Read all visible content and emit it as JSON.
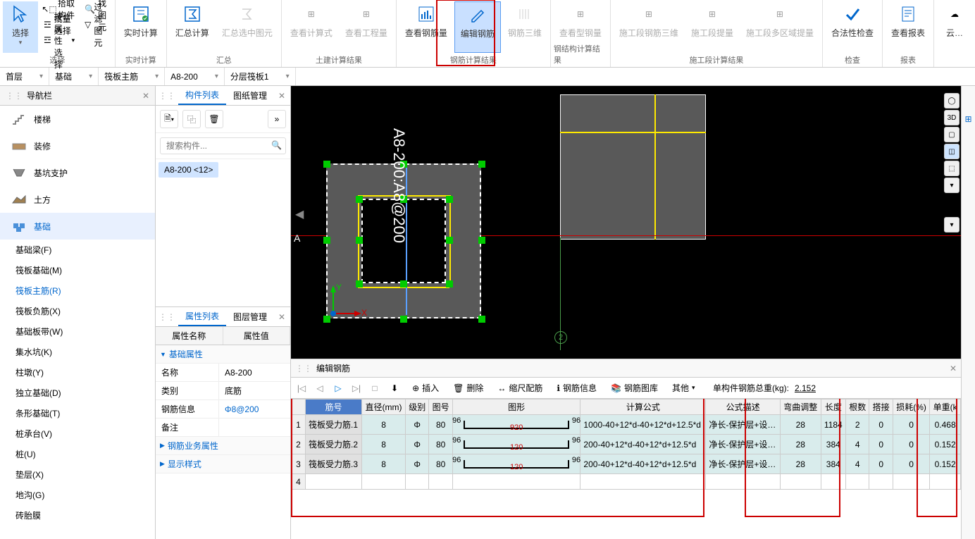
{
  "ribbon": {
    "groups": [
      {
        "label": "选择",
        "select_big": "选择",
        "items": [
          "拾取构件",
          "批量选择",
          "按属性选择",
          "查找图元",
          "过滤图元"
        ]
      },
      {
        "label": "实时计算",
        "big": [
          "实时计算"
        ]
      },
      {
        "label": "汇总",
        "big": [
          "汇总计算",
          "汇总选中图元"
        ]
      },
      {
        "label": "土建计算结果",
        "big": [
          "查看计算式",
          "查看工程量"
        ]
      },
      {
        "label": "钢筋计算结果",
        "big": [
          "查看钢筋量",
          "编辑钢筋",
          "钢筋三维"
        ]
      },
      {
        "label": "钢结构计算结果",
        "big": [
          "查看型钢量"
        ]
      },
      {
        "label": "施工段计算结果",
        "big": [
          "施工段钢筋三维",
          "施工段提量",
          "施工段多区域提量"
        ]
      },
      {
        "label": "检查",
        "big": [
          "合法性检查"
        ]
      },
      {
        "label": "报表",
        "big": [
          "查看报表"
        ]
      },
      {
        "label": "",
        "big": [
          "云…"
        ]
      }
    ]
  },
  "secondary": {
    "items": [
      "首层",
      "基础",
      "筏板主筋",
      "A8-200",
      "分层筏板1"
    ]
  },
  "leftNav": {
    "title": "导航栏",
    "items": [
      {
        "label": "楼梯",
        "icon": "stairs"
      },
      {
        "label": "装修",
        "icon": "decor"
      },
      {
        "label": "基坑支护",
        "icon": "pit"
      },
      {
        "label": "土方",
        "icon": "earth"
      },
      {
        "label": "基础",
        "icon": "foundation",
        "active": true
      }
    ],
    "subs": [
      "基础梁(F)",
      "筏板基础(M)",
      "筏板主筋(R)",
      "筏板负筋(X)",
      "基础板带(W)",
      "集水坑(K)",
      "柱墩(Y)",
      "独立基础(D)",
      "条形基础(T)",
      "桩承台(V)",
      "桩(U)",
      "垫层(X)",
      "地沟(G)",
      "砖胎膜"
    ],
    "subActive": 2
  },
  "compPanel": {
    "tabs": [
      "构件列表",
      "图纸管理"
    ],
    "searchPlaceholder": "搜索构件...",
    "item": "A8-200 <12>"
  },
  "propsPanel": {
    "tabs": [
      "属性列表",
      "图层管理"
    ],
    "headers": [
      "属性名称",
      "属性值"
    ],
    "groups": {
      "basic": "基础属性",
      "biz": "钢筋业务属性",
      "display": "显示样式"
    },
    "rows": [
      {
        "name": "名称",
        "val": "A8-200"
      },
      {
        "name": "类别",
        "val": "底筋"
      },
      {
        "name": "钢筋信息",
        "val": "Φ8@200",
        "link": true
      },
      {
        "name": "备注",
        "val": ""
      }
    ]
  },
  "canvas": {
    "axisLabel": "A8-200:A8@200",
    "marker": "2",
    "axes": {
      "x": "X",
      "y": "Y"
    },
    "originA": "A"
  },
  "bottomPanel": {
    "title": "编辑钢筋",
    "toolbar": {
      "insert": "插入",
      "delete": "删除",
      "scale": "缩尺配筋",
      "info": "钢筋信息",
      "lib": "钢筋图库",
      "other": "其他",
      "total_label": "单构件钢筋总重(kg):",
      "total_val": "2.152"
    },
    "headers": [
      "筋号",
      "直径(mm)",
      "级别",
      "图号",
      "图形",
      "计算公式",
      "公式描述",
      "弯曲调整",
      "长度",
      "根数",
      "搭接",
      "损耗(%)",
      "单重(k"
    ],
    "rows": [
      {
        "num": "1",
        "name": "筏板受力筋.1",
        "dia": "8",
        "grade": "Φ",
        "shape": "80",
        "end_l": "96",
        "mid": "920",
        "end_r": "96",
        "formula": "1000-40+12*d-40+12*d+12.5*d",
        "desc": "净长-保护层+设…",
        "bend": "28",
        "len": "1184",
        "count": "2",
        "lap": "0",
        "loss": "0",
        "wt": "0.468"
      },
      {
        "num": "2",
        "name": "筏板受力筋.2",
        "dia": "8",
        "grade": "Φ",
        "shape": "80",
        "end_l": "96",
        "mid": "120",
        "end_r": "96",
        "formula": "200-40+12*d-40+12*d+12.5*d",
        "desc": "净长-保护层+设…",
        "bend": "28",
        "len": "384",
        "count": "4",
        "lap": "0",
        "loss": "0",
        "wt": "0.152"
      },
      {
        "num": "3",
        "name": "筏板受力筋.3",
        "dia": "8",
        "grade": "Φ",
        "shape": "80",
        "end_l": "96",
        "mid": "120",
        "end_r": "96",
        "formula": "200-40+12*d-40+12*d+12.5*d",
        "desc": "净长-保护层+设…",
        "bend": "28",
        "len": "384",
        "count": "4",
        "lap": "0",
        "loss": "0",
        "wt": "0.152"
      }
    ]
  }
}
